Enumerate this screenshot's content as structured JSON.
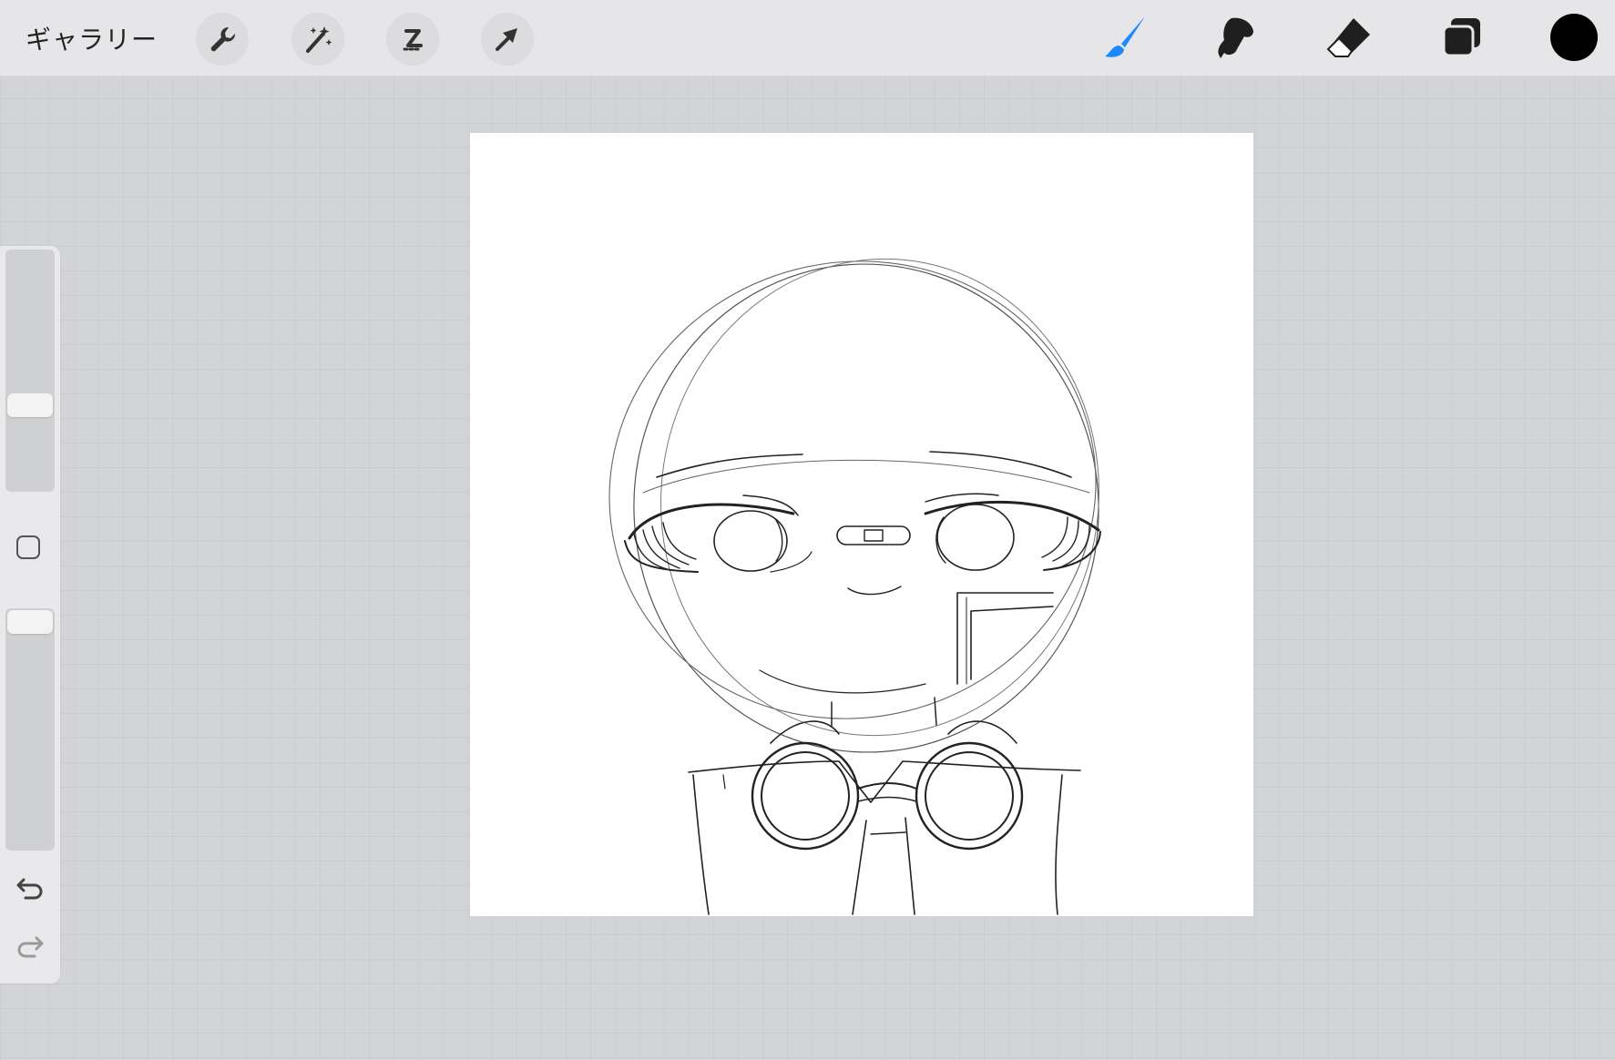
{
  "app": {
    "gallery_label": "ギャラリー"
  },
  "toolbar_left": [
    {
      "name": "actions",
      "icon": "wrench-icon"
    },
    {
      "name": "adjustments",
      "icon": "magic-wand-icon"
    },
    {
      "name": "selection",
      "icon": "selection-s-icon"
    },
    {
      "name": "transform",
      "icon": "arrow-cursor-icon"
    }
  ],
  "toolbar_right": [
    {
      "name": "brush",
      "icon": "brush-icon",
      "active": true
    },
    {
      "name": "smudge",
      "icon": "smudge-icon",
      "active": false
    },
    {
      "name": "eraser",
      "icon": "eraser-icon",
      "active": false
    },
    {
      "name": "layers",
      "icon": "layers-icon",
      "active": false
    }
  ],
  "colors": {
    "current_color": "#000000",
    "active_tool": "#1e88ff",
    "toolbar_bg": "#e6e6e8",
    "workspace_bg": "#d3d4d6",
    "canvas_bg": "#ffffff"
  },
  "sidebar": {
    "brush_size_level": 0.35,
    "opacity_level": 0.95,
    "modifier_icon": "square-modifier-icon",
    "undo_icon": "undo-icon",
    "redo_icon": "redo-icon"
  }
}
